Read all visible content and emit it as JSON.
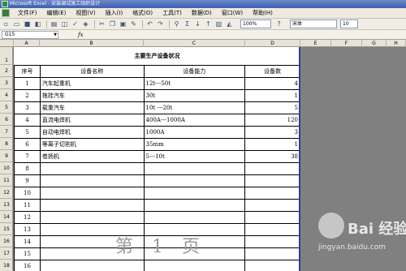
{
  "window": {
    "title": "Microsoft Excel - 安装调试施工组织设计"
  },
  "menu": [
    "文件(F)",
    "编辑(E)",
    "视图(V)",
    "插入(I)",
    "格式(O)",
    "工具(T)",
    "数据(D)",
    "窗口(W)",
    "帮助(H)"
  ],
  "toolbar": {
    "zoom": "100%",
    "font": "宋体",
    "font_size": "10",
    "sigma": "Σ"
  },
  "formula_bar": {
    "cell_ref": "G15",
    "fx": "fx"
  },
  "columns": [
    "A",
    "B",
    "C",
    "D",
    "E",
    "F",
    "G",
    "H"
  ],
  "rows": [
    "1",
    "2",
    "3",
    "4",
    "5",
    "6",
    "7",
    "8",
    "9",
    "10",
    "11",
    "12",
    "13",
    "14",
    "15",
    "16",
    "17",
    "18"
  ],
  "table": {
    "title": "主要生产设备状况",
    "headers": [
      "序号",
      "设备名称",
      "设备能力",
      "设备数"
    ],
    "body": [
      [
        "1",
        "汽车起重机",
        "12t---50t",
        "4"
      ],
      [
        "2",
        "拖挂汽车",
        "30t",
        "1"
      ],
      [
        "3",
        "载重汽车",
        "10t ---20t",
        "5"
      ],
      [
        "4",
        "直流电焊机",
        "400A---1000A",
        "120"
      ],
      [
        "5",
        "自动电焊机",
        "1000A",
        "3"
      ],
      [
        "6",
        "等离子切割机",
        "35mm",
        "1"
      ],
      [
        "7",
        "卷扬机",
        "5---10t",
        "38"
      ],
      [
        "8",
        "",
        "",
        ""
      ],
      [
        "9",
        "",
        "",
        ""
      ],
      [
        "10",
        "",
        "",
        ""
      ],
      [
        "11",
        "",
        "",
        ""
      ],
      [
        "12",
        "",
        "",
        ""
      ],
      [
        "13",
        "",
        "",
        ""
      ],
      [
        "14",
        "",
        "",
        ""
      ],
      [
        "15",
        "",
        "",
        ""
      ],
      [
        "16",
        "",
        "",
        ""
      ]
    ]
  },
  "watermark": {
    "page_label": "第 1 页",
    "brand": "Bai 经验",
    "url": "jingyan.baidu.com"
  }
}
